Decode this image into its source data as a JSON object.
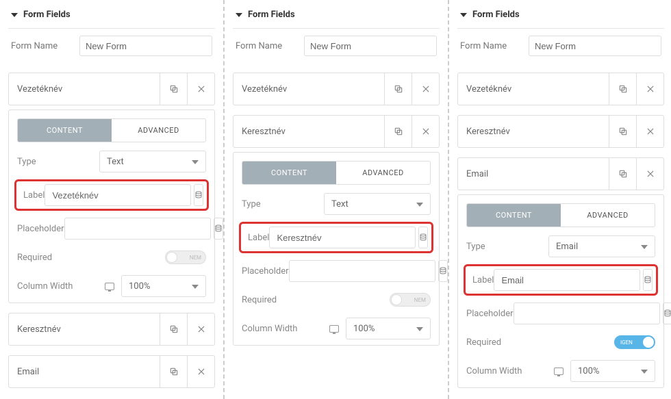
{
  "sections": {
    "heading": "Form Fields",
    "formNameLabel": "Form Name",
    "formNameValue": "New Form"
  },
  "tabs": {
    "content": "CONTENT",
    "advanced": "ADVANCED"
  },
  "labels": {
    "type": "Type",
    "label": "Label",
    "placeholder": "Placeholder",
    "required": "Required",
    "columnWidth": "Column Width"
  },
  "toggle": {
    "off": "NEM",
    "on": "IGEN"
  },
  "cols": [
    {
      "fields": [
        {
          "title": "Vezetéknév",
          "expanded": true,
          "type": "Text",
          "labelValue": "Vezetéknév",
          "placeholder": "",
          "required": false,
          "columnWidth": "100%"
        },
        {
          "title": "Keresztnév",
          "expanded": false
        },
        {
          "title": "Email",
          "expanded": false
        }
      ]
    },
    {
      "fields": [
        {
          "title": "Vezetéknév",
          "expanded": false
        },
        {
          "title": "Keresztnév",
          "expanded": true,
          "type": "Text",
          "labelValue": "Keresztnév",
          "placeholder": "",
          "required": false,
          "columnWidth": "100%"
        }
      ]
    },
    {
      "fields": [
        {
          "title": "Vezetéknév",
          "expanded": false
        },
        {
          "title": "Keresztnév",
          "expanded": false
        },
        {
          "title": "Email",
          "expanded": true,
          "type": "Email",
          "labelValue": "Email",
          "placeholder": "",
          "required": true,
          "columnWidth": "100%"
        }
      ]
    }
  ]
}
